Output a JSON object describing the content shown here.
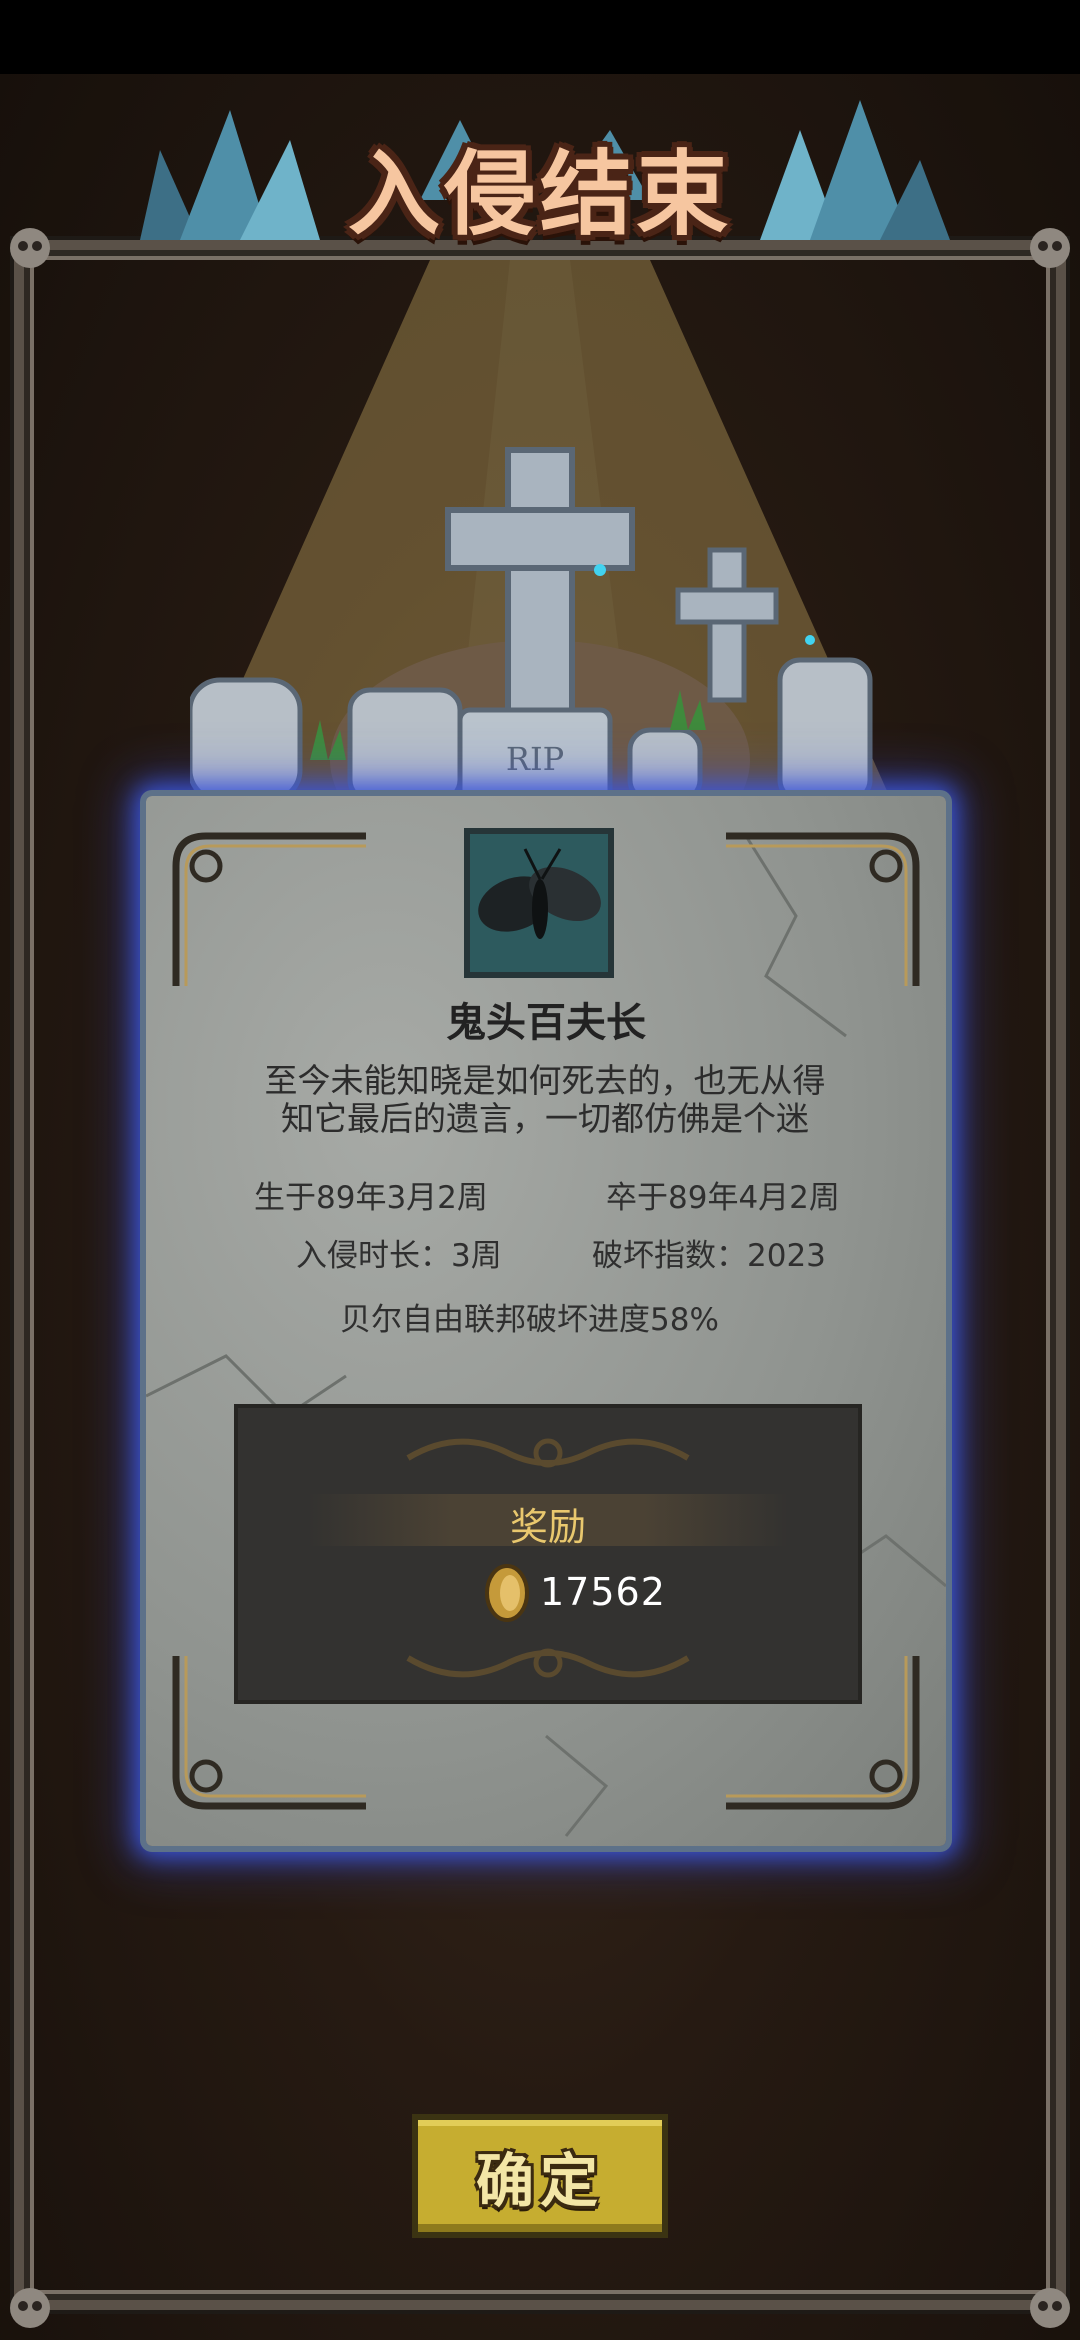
{
  "header": {
    "title": "入侵结束"
  },
  "graveyard": {
    "rip_text": "RIP"
  },
  "creature": {
    "name": "鬼头百夫长",
    "epitaph_line1": "至今未能知晓是如何死去的，也无从得",
    "epitaph_line2": "知它最后的遗言，一切都仿佛是个迷",
    "born": "生于89年3月2周",
    "died": "卒于89年4月2周",
    "duration": "入侵时长：3周",
    "damage_index": "破坏指数：2023",
    "progress": "贝尔自由联邦破坏进度58%"
  },
  "reward": {
    "label": "奖励",
    "currency_icon": "gold-coin-icon",
    "amount": "17562"
  },
  "actions": {
    "confirm_label": "确定"
  },
  "colors": {
    "title": "#f6c6a0",
    "reward_label": "#e9c86e",
    "confirm_button": "#c6ad30",
    "stone_glow": "#3b55d8"
  }
}
